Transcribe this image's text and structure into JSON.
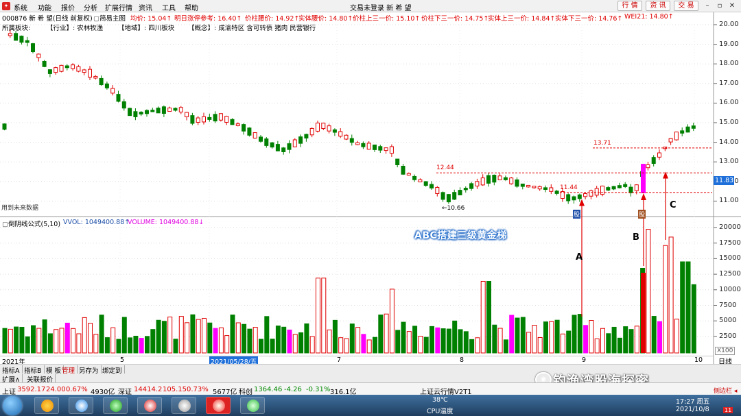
{
  "menubar": {
    "items": [
      "系统",
      "功能",
      "报价",
      "分析",
      "扩展行情",
      "资讯",
      "工具",
      "帮助"
    ],
    "window_title": "交易未登录 新 希 望",
    "right_buttons": [
      "行 情",
      "资 讯",
      "交 易"
    ]
  },
  "infobar": {
    "code_name": "000876 新 希 望(日线 前复权)",
    "main_chart_label": "简易主图",
    "indicators": [
      {
        "label": "均价: 15.04↑",
        "color": "#e00000"
      },
      {
        "label": "明日涨停参考: 16.40↑",
        "color": "#e00000"
      },
      {
        "label": "价柱腰价: 14.92↑",
        "color": "#e00000"
      },
      {
        "label": "实体腰价: 14.80↑",
        "color": "#e00000"
      },
      {
        "label": "价柱上三一价: 15.10↑",
        "color": "#e00000"
      },
      {
        "label": "价柱下三一价: 14.75↑",
        "color": "#e00000"
      },
      {
        "label": "实体上三一价: 14.84↑",
        "color": "#e00000"
      },
      {
        "label": "实体下三一价: 14.76↑",
        "color": "#e00000"
      },
      {
        "label": "WEI21: 14.80↑",
        "color": "#e00000"
      }
    ]
  },
  "tagline": {
    "prefix": "所属板块:",
    "industry": "【行业】: 农林牧渔",
    "region": "【地域】: 四川板块",
    "concept": "【概念】: 成渝特区 含可转债 猪肉 民营银行"
  },
  "price_axis": {
    "labels": [
      "20.00",
      "19.00",
      "18.00",
      "17.00",
      "16.00",
      "15.00",
      "14.00",
      "13.00",
      "12.00",
      "11.00"
    ],
    "current_price": "11.83"
  },
  "volume_axis": {
    "labels": [
      "20000",
      "17500",
      "15000",
      "12500",
      "10000",
      "7500",
      "5000",
      "2500"
    ],
    "unit": "X100"
  },
  "price_notes": {
    "low_label": "←10.66",
    "level_1244": "12.44",
    "level_1144": "11.44",
    "level_1371": "13.71",
    "future_data": "用到未来数据",
    "marker_1": "股",
    "marker_2": "股"
  },
  "volume_legend": {
    "formula": "倒阴线公式(5,10)",
    "vvol": "VVOL: 1049400.88↑",
    "volume": "VOLUME: 1049400.88↓"
  },
  "annotation": {
    "caption": "ABC搭建三级黄金梯",
    "a": "A",
    "b": "B",
    "c": "C"
  },
  "date_axis": {
    "year": "2021年",
    "m5": "5",
    "m6_highlight": "2021/05/28/五",
    "m7": "7",
    "m8": "8",
    "m9": "9",
    "m10": "10",
    "period": "日线"
  },
  "tabs": [
    "指标A",
    "指标B",
    "模 板",
    "管理",
    "另存为",
    "绑定到"
  ],
  "tabs2": [
    "扩展∧",
    "关联报价"
  ],
  "status": {
    "sh_label": "上证",
    "sh_value": "3592.17",
    "sh_change": "24.00",
    "sh_pct": "0.67%",
    "sh_amount": "4930亿",
    "sz_label": "深证",
    "sz_value": "14414.2",
    "sz_change": "105.15",
    "sz_pct": "0.73%",
    "sz_amount": "5677亿",
    "kc_label": "科创",
    "kc_value": "1364.46",
    "kc_change": "-4.26",
    "kc_pct": "-0.31%",
    "kc_amount": "316.1亿",
    "news": "上证云行情V2T1",
    "right_tag": "侧边栏 ◂"
  },
  "taskbar": {
    "temp": "38℃",
    "cpu": "CPU温度",
    "time": "17:27 周五",
    "date": "2021/10/8",
    "notif": "11"
  },
  "watermark": "钓渔湾股海探密"
}
